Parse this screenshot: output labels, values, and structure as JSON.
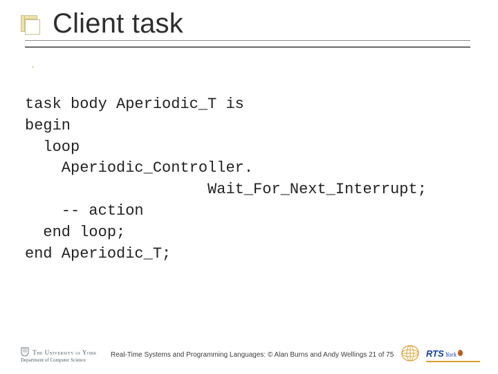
{
  "title": "Client task",
  "code": {
    "l1": "task body Aperiodic_T is",
    "l2": "begin",
    "l3": "  loop",
    "l4": "    Aperiodic_Controller.",
    "l5": "                    Wait_For_Next_Interrupt;",
    "l6": "    -- action",
    "l7": "  end loop;",
    "l8": "end Aperiodic_T;"
  },
  "footer": {
    "uoy_line1_pre": "The University ",
    "uoy_line1_of": "of",
    "uoy_line1_post": " York",
    "uoy_line2": "Department of Computer Science",
    "text": "Real-Time Systems and Programming Languages: © Alan Burns and Andy Wellings 21 of 75",
    "rts_label": "RTS",
    "rts_sub": "York"
  }
}
